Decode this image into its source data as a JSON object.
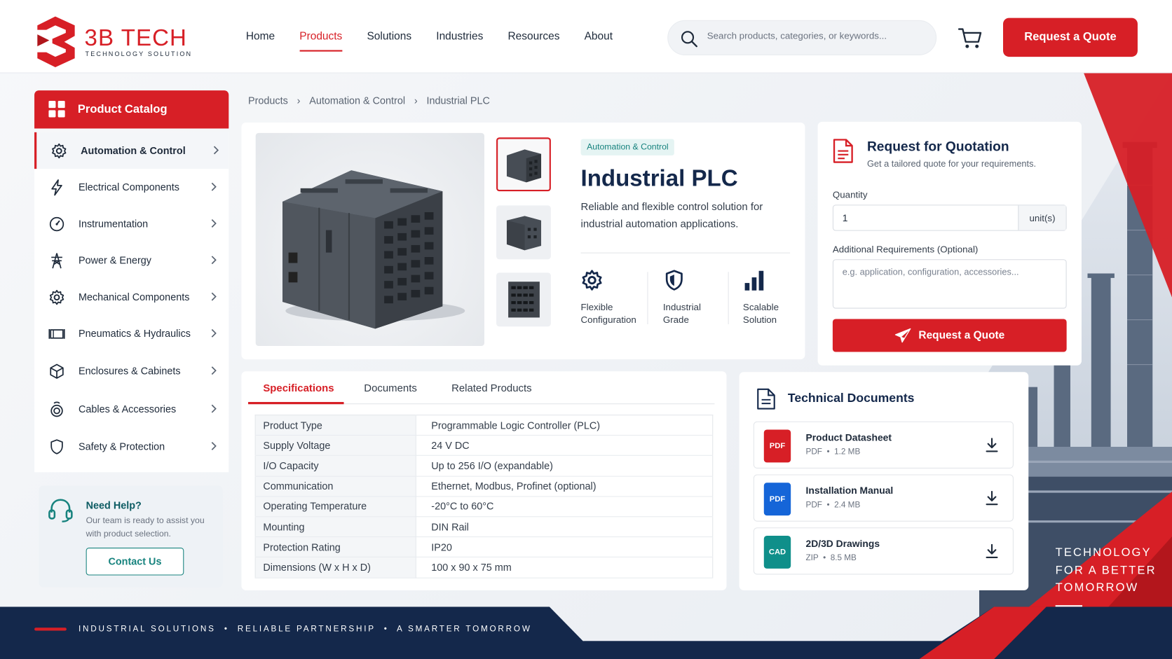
{
  "brand": {
    "name": "3B TECH",
    "tagline": "TECHNOLOGY SOLUTION",
    "accent": "#d71f26",
    "navy": "#14284b",
    "teal": "#17837e"
  },
  "nav": {
    "items": [
      "Home",
      "Products",
      "Solutions",
      "Industries",
      "Resources",
      "About"
    ],
    "active": "Products"
  },
  "search": {
    "placeholder": "Search products, categories, or keywords..."
  },
  "header": {
    "quote_label": "Request a Quote",
    "cart_icon": "cart-icon"
  },
  "sidebar": {
    "title": "Product Catalog",
    "items": [
      {
        "label": "Automation & Control",
        "icon": "gear-icon",
        "active": true
      },
      {
        "label": "Electrical Components",
        "icon": "lightning-icon"
      },
      {
        "label": "Instrumentation",
        "icon": "gauge-icon"
      },
      {
        "label": "Power & Energy",
        "icon": "power-tower-icon"
      },
      {
        "label": "Mechanical Components",
        "icon": "cog-icon"
      },
      {
        "label": "Pneumatics & Hydraulics",
        "icon": "cylinder-icon"
      },
      {
        "label": "Enclosures & Cabinets",
        "icon": "box-icon"
      },
      {
        "label": "Cables & Accessories",
        "icon": "cable-icon"
      },
      {
        "label": "Safety & Protection",
        "icon": "shield-icon"
      }
    ],
    "help": {
      "title": "Need Help?",
      "text": "Our team is ready to assist you with product selection.",
      "button": "Contact Us"
    }
  },
  "breadcrumb": [
    "Products",
    "Automation & Control",
    "Industrial PLC"
  ],
  "product": {
    "category_badge": "Automation & Control",
    "title": "Industrial PLC",
    "description": "Reliable and flexible control solution for industrial automation applications.",
    "features": [
      {
        "line1": "Flexible",
        "line2": "Configuration",
        "icon": "gear-icon"
      },
      {
        "line1": "Industrial",
        "line2": "Grade",
        "icon": "shield-icon"
      },
      {
        "line1": "Scalable",
        "line2": "Solution",
        "icon": "bar-chart-icon"
      }
    ]
  },
  "rfq": {
    "title": "Request for Quotation",
    "subtitle": "Get a tailored quote for your requirements.",
    "quantity_label": "Quantity",
    "quantity_value": "1",
    "unit": "unit(s)",
    "requirements_label": "Additional Requirements (Optional)",
    "requirements_placeholder": "e.g. application, configuration, accessories...",
    "button": "Request a Quote"
  },
  "tabs": {
    "items": [
      "Specifications",
      "Documents",
      "Related Products"
    ],
    "active": "Specifications"
  },
  "specs": [
    {
      "key": "Product Type",
      "value": "Programmable Logic Controller (PLC)"
    },
    {
      "key": "Supply Voltage",
      "value": "24 V DC"
    },
    {
      "key": "I/O Capacity",
      "value": "Up to 256 I/O (expandable)"
    },
    {
      "key": "Communication",
      "value": "Ethernet, Modbus, Profinet (optional)"
    },
    {
      "key": "Operating Temperature",
      "value": "-20°C to 60°C"
    },
    {
      "key": "Mounting",
      "value": "DIN Rail"
    },
    {
      "key": "Protection Rating",
      "value": "IP20"
    },
    {
      "key": "Dimensions (W x H x D)",
      "value": "100 x 90 x 75 mm"
    }
  ],
  "documents": {
    "title": "Technical Documents",
    "items": [
      {
        "name": "Product Datasheet",
        "type": "PDF",
        "size": "1.2 MB",
        "badge": "PDF",
        "color": "#d71f26"
      },
      {
        "name": "Installation Manual",
        "type": "PDF",
        "size": "2.4 MB",
        "badge": "PDF",
        "color": "#1565d8"
      },
      {
        "name": "2D/3D Drawings",
        "type": "ZIP",
        "size": "8.5 MB",
        "badge": "CAD",
        "color": "#0f8f8a"
      }
    ]
  },
  "hero_tagline": [
    "TECHNOLOGY",
    "FOR A BETTER",
    "TOMORROW"
  ],
  "footer": {
    "text": "INDUSTRIAL SOLUTIONS  •  RELIABLE PARTNERSHIP  •  A SMARTER TOMORROW"
  }
}
